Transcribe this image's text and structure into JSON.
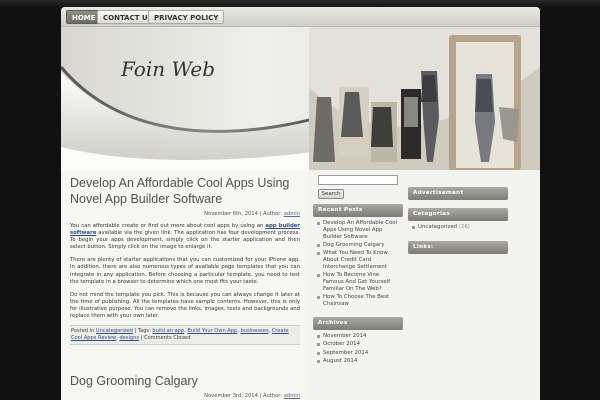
{
  "nav": {
    "home": "HOME",
    "contact": "CONTACT US",
    "privacy": "PRIVACY POLICY"
  },
  "site": {
    "title": "Foin Web"
  },
  "search": {
    "button": "Search"
  },
  "posts": [
    {
      "title": "Develop An Affordable Cool Apps Using Novel App Builder Software",
      "date": "November 6th, 2014",
      "author_label": "Author:",
      "author": "admin",
      "p1_before": "You can affordable create or find out more about cool apps by using an ",
      "p1_link": "app builder software",
      "p1_after": " available via the given link. The application has four development process. To begin your apps development, simply click on the starter application and then select button. Simply click on the image to enlarge it.",
      "p2": "There are plenty of starter applications that you can customized for your iPhone app. In addition, there are also numerous types of available page templates that you can integrate in any application. Before choosing a particular template, you need to test the template in a browser to determine which one most fits your taste.",
      "p3": "Do not mind the template you pick. This is because you can always change it later at the time of publishing. All the templates have sample contents. However, this is only for illustrative purpose. You can remove the links, images, texts and backgrounds and replace them with your own later.",
      "footer": {
        "posted_in": "Posted in",
        "category": "Uncategorized",
        "tags_label": "| Tags:",
        "tags": [
          "build an app",
          "Build Your Own App",
          "businesses",
          "Create Cool Apps Review",
          "designs"
        ],
        "comments": "| Comments Closed"
      }
    },
    {
      "title": "Dog Grooming Calgary",
      "date": "November 3rd, 2014",
      "author_label": "Author:",
      "author": "admin"
    }
  ],
  "sidebar_left": {
    "recent_title": "Recent Posts",
    "recent": [
      "Develop An Affordable Cool Apps Using Novel App Builder Software",
      "Dog Grooming Calgary",
      "What You Need To Know About Credit Card Interchange Settlement",
      "How To Become Vine Famous And Get Yourself Familiar On The Web?",
      "How To Choose The Best Chainsaw"
    ],
    "archives_title": "Archives",
    "archives": [
      "November 2014",
      "October 2014",
      "September 2014",
      "August 2014"
    ]
  },
  "sidebar_right": {
    "advertisement_title": "Advertisement",
    "categories_title": "Categories",
    "category": "Uncategorized",
    "category_count": "(26)",
    "links_title": "Links:"
  }
}
